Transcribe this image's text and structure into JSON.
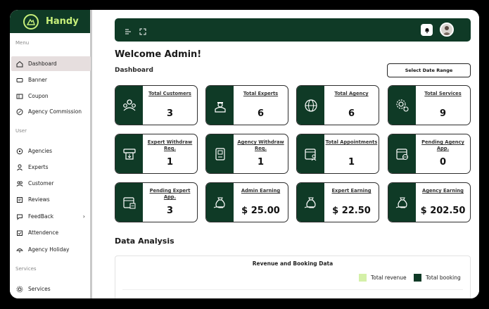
{
  "brand": {
    "name": "Handy",
    "accent": "#c7ef7a",
    "primary": "#0f3a26"
  },
  "sidebar": {
    "sections": {
      "menu": "Menu",
      "user": "User",
      "services": "Services"
    },
    "items": [
      {
        "label": "Dashboard",
        "icon": "home-icon",
        "active": true
      },
      {
        "label": "Banner",
        "icon": "banner-icon"
      },
      {
        "label": "Coupon",
        "icon": "coupon-icon"
      },
      {
        "label": "Agency Commission",
        "icon": "commission-icon"
      },
      {
        "label": "Agencies",
        "icon": "agencies-icon"
      },
      {
        "label": "Experts",
        "icon": "experts-icon"
      },
      {
        "label": "Customer",
        "icon": "customer-icon"
      },
      {
        "label": "Reviews",
        "icon": "reviews-icon"
      },
      {
        "label": "FeedBack",
        "icon": "feedback-icon",
        "chevron": "›"
      },
      {
        "label": "Attendence",
        "icon": "attendance-icon"
      },
      {
        "label": "Agency Holiday",
        "icon": "holiday-icon"
      },
      {
        "label": "Services",
        "icon": "services-icon"
      }
    ]
  },
  "header": {
    "welcome": "Welcome Admin!",
    "section": "Dashboard",
    "date_button": "Select Date Range"
  },
  "cards": [
    {
      "title": "Total Customers",
      "value": "3",
      "icon": "customers-icon"
    },
    {
      "title": "Total Experts",
      "value": "6",
      "icon": "experts-icon"
    },
    {
      "title": "Total Agency",
      "value": "6",
      "icon": "globe-icon"
    },
    {
      "title": "Total Services",
      "value": "9",
      "icon": "gears-icon"
    },
    {
      "title": "Expert Withdraw Req.",
      "value": "1",
      "icon": "withdraw-icon"
    },
    {
      "title": "Agency Withdraw Req.",
      "value": "1",
      "icon": "atm-icon"
    },
    {
      "title": "Total Appointments",
      "value": "1",
      "icon": "calendar-user-icon"
    },
    {
      "title": "Pending Agency App.",
      "value": "0",
      "icon": "calendar-globe-icon"
    },
    {
      "title": "Pending Expert App.",
      "value": "3",
      "icon": "calendar-pending-icon"
    },
    {
      "title": "Admin Earning",
      "value": "$ 25.00",
      "icon": "money-bag-icon"
    },
    {
      "title": "Expert Earning",
      "value": "$ 22.50",
      "icon": "money-bag-icon"
    },
    {
      "title": "Agency Earning",
      "value": "$ 202.50",
      "icon": "money-bag-icon"
    }
  ],
  "analysis": {
    "title": "Data Analysis",
    "chart_title": "Revenue and Booking Data",
    "legend": [
      {
        "label": "Total revenue",
        "color": "#d4f0a8"
      },
      {
        "label": "Total booking",
        "color": "#0f3a26"
      }
    ]
  }
}
